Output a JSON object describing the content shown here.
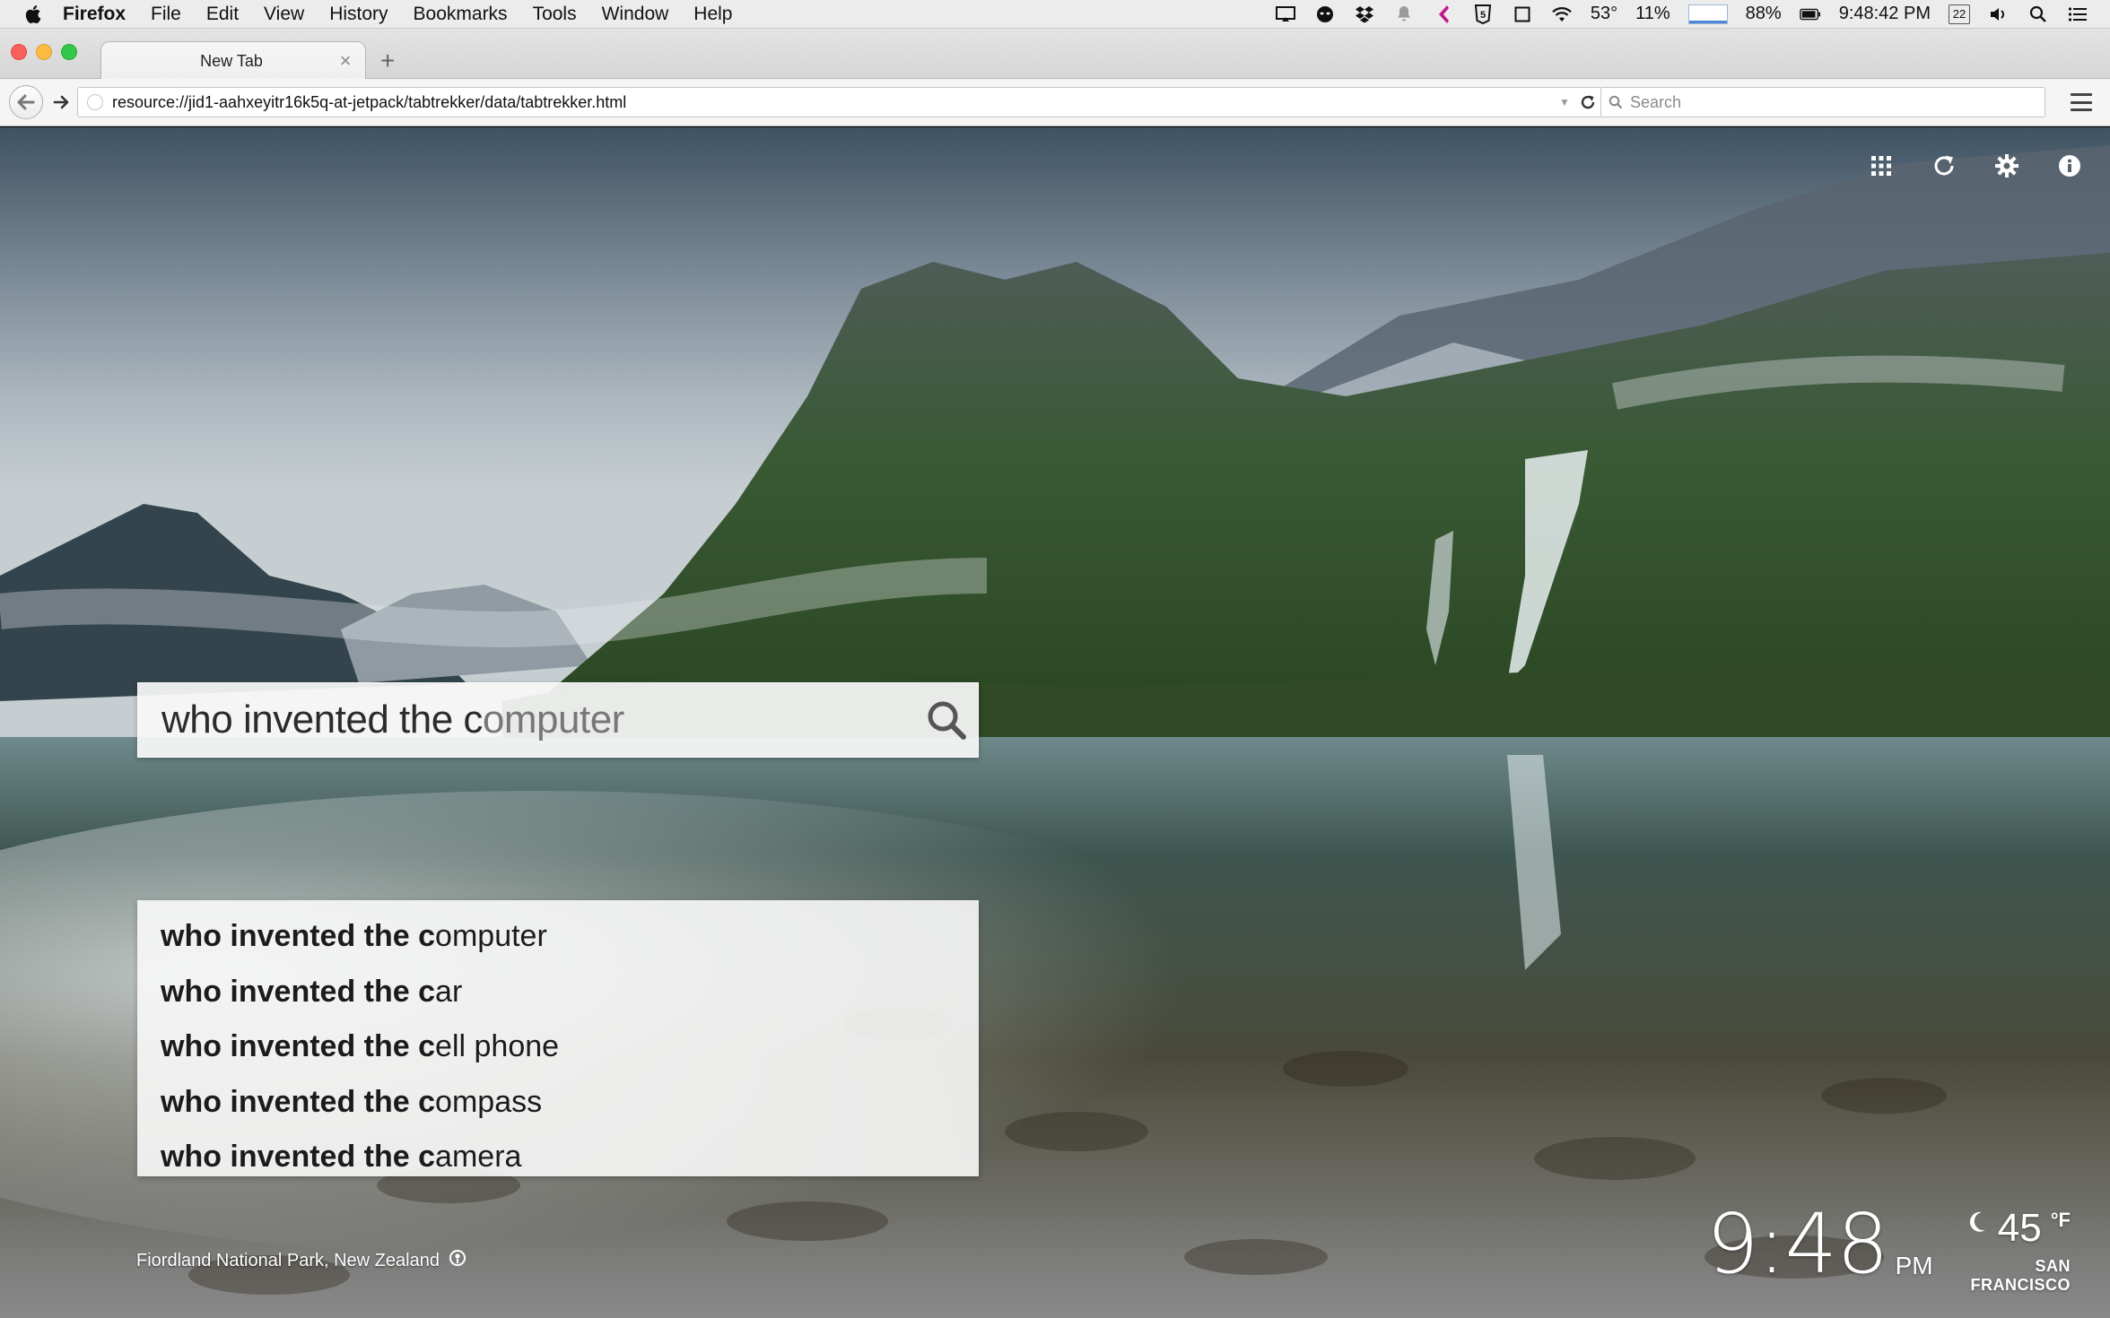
{
  "menubar": {
    "app_name": "Firefox",
    "menus": [
      "File",
      "Edit",
      "View",
      "History",
      "Bookmarks",
      "Tools",
      "Window",
      "Help"
    ],
    "status": {
      "temperature": "53°",
      "cpu": "11%",
      "battery": "88%",
      "time": "9:48:42 PM",
      "calendar_day": "22"
    }
  },
  "browser": {
    "tab_title": "New Tab",
    "url": "resource://jid1-aahxeyitr16k5q-at-jetpack/tabtrekker/data/tabtrekker.html",
    "search_placeholder": "Search"
  },
  "page": {
    "search": {
      "typed": "who invented the c",
      "completion": "omputer"
    },
    "suggestions": [
      {
        "prefix": "who invented the c",
        "rest": "omputer"
      },
      {
        "prefix": "who invented the c",
        "rest": "ar"
      },
      {
        "prefix": "who invented the c",
        "rest": "ell phone"
      },
      {
        "prefix": "who invented the c",
        "rest": "ompass"
      },
      {
        "prefix": "who invented the c",
        "rest": "amera"
      }
    ],
    "location_caption": "Fiordland National Park, New Zealand",
    "clock": {
      "time": "9:48",
      "ampm": "PM"
    },
    "weather": {
      "temp": "45",
      "unit": "°F",
      "city": "SAN FRANCISCO"
    }
  },
  "colors": {
    "accent_close": "#fc605c",
    "accent_min": "#fdbc40",
    "accent_max": "#34c84a"
  }
}
